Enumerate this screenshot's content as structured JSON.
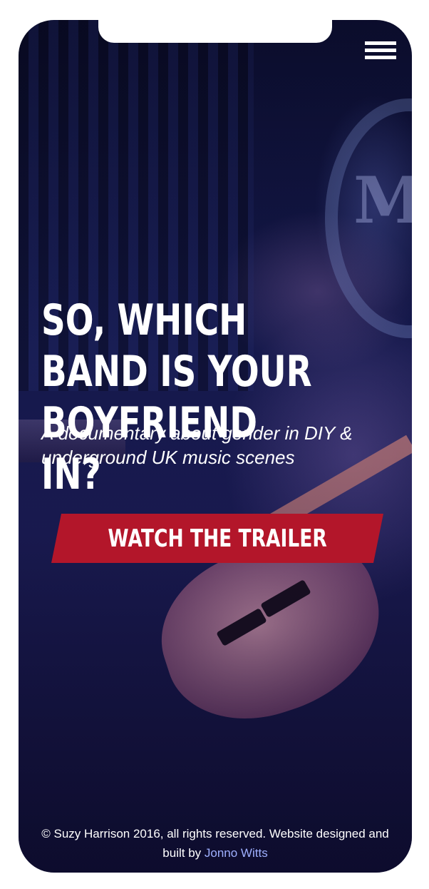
{
  "menu": {
    "icon": "hamburger-menu-icon"
  },
  "hero": {
    "headline": "So, which band is your boyfriend in?",
    "subtitle": "A documentary about gender in DIY & underground UK music scenes",
    "cta_label": "Watch the trailer"
  },
  "footer": {
    "text": "© Suzy Harrison 2016, all rights reserved. Website designed and built by",
    "link_label": "Jonno Witts"
  },
  "colors": {
    "accent": "#b3162a",
    "link": "#9fb0ff",
    "background": "#14184a"
  }
}
